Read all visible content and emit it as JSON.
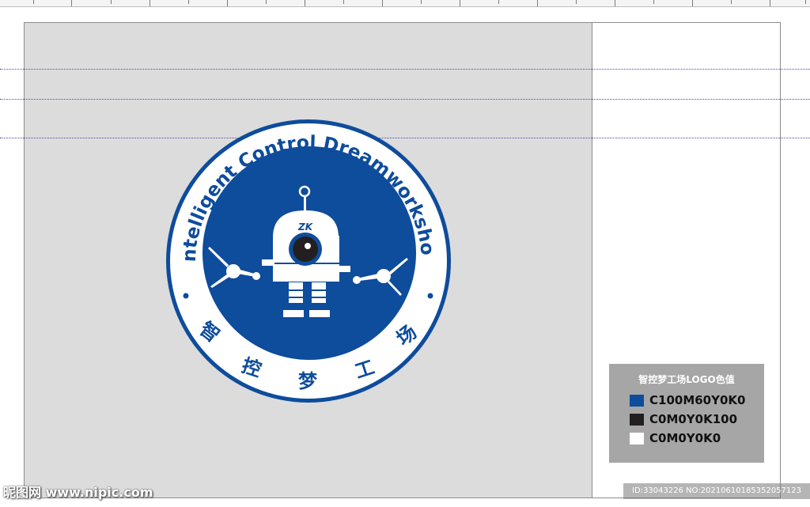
{
  "logo": {
    "arc_text": "Intelligent Control Dreamworkshop",
    "bottom_chars": [
      "智",
      "控",
      "梦",
      "工",
      "场"
    ],
    "robot_badge": "ZK"
  },
  "legend": {
    "title": "智控梦工场LOGO色值",
    "items": [
      {
        "label": "C100M60Y0K0",
        "color": "#0e4c9c"
      },
      {
        "label": "C0M0Y0K100",
        "color": "#231f20"
      },
      {
        "label": "C0M0Y0K0",
        "color": "#ffffff"
      }
    ]
  },
  "watermark": {
    "left": "昵图网 www.nipic.com",
    "right": "ID:33043226 NO:20210610185352057123"
  },
  "colors": {
    "brand_blue": "#0e4c9c",
    "artboard_gray": "#dcdcdc",
    "legend_gray": "#a6a6a6"
  }
}
